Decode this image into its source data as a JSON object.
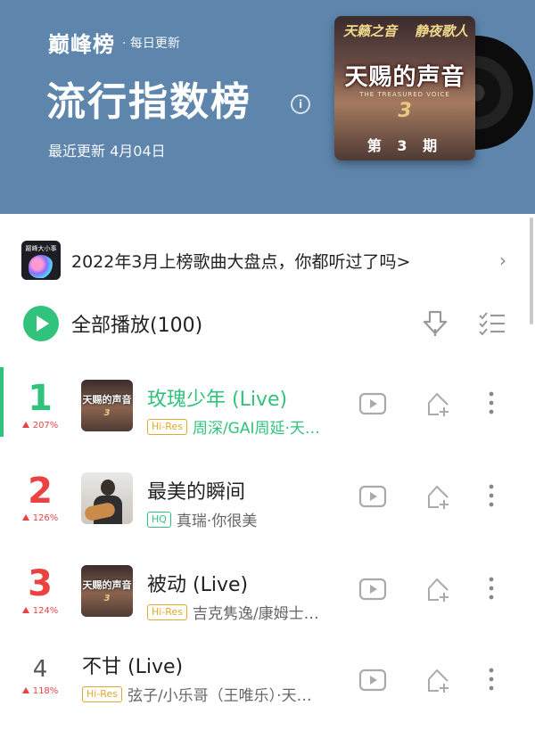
{
  "header": {
    "brand": "巅峰榜",
    "brand_sub": "· 每日更新",
    "title": "流行指数榜",
    "info_glyph": "i",
    "updated": "最近更新 4月04日",
    "album": {
      "script_left": "天籁之音",
      "script_right": "静夜歌人",
      "title": "天赐的声音",
      "subtitle": "THE TREASURED VOICE",
      "season_num": "3",
      "episode": "第 3 期"
    }
  },
  "banner": {
    "thumb_text": "巅峰大小事",
    "text": "2022年3月上榜歌曲大盘点，你都听过了吗>",
    "chevron": "›"
  },
  "play_all": {
    "label": "全部播放(100)"
  },
  "songs": [
    {
      "rank": "1",
      "change": "207%",
      "title": "玫瑰少年 (Live)",
      "tag": "Hi-Res",
      "artist": "周深/GAI周延·天…",
      "cover_title": "天赐的声音",
      "cover_num": "3"
    },
    {
      "rank": "2",
      "change": "126%",
      "title": "最美的瞬间",
      "tag": "HQ",
      "artist": "真瑞·你很美"
    },
    {
      "rank": "3",
      "change": "124%",
      "title": "被动 (Live)",
      "tag": "Hi-Res",
      "artist": "吉克隽逸/康姆士…",
      "cover_title": "天赐的声音",
      "cover_num": "3"
    },
    {
      "rank": "4",
      "change": "118%",
      "title": "不甘 (Live)",
      "tag": "Hi-Res",
      "artist": "弦子/小乐哥（王唯乐）·天…"
    }
  ],
  "colors": {
    "header_bg": "#5e86ad",
    "accent_green": "#31c27c",
    "rank_red": "#ec4141",
    "hires_gold": "#e0a82e"
  }
}
